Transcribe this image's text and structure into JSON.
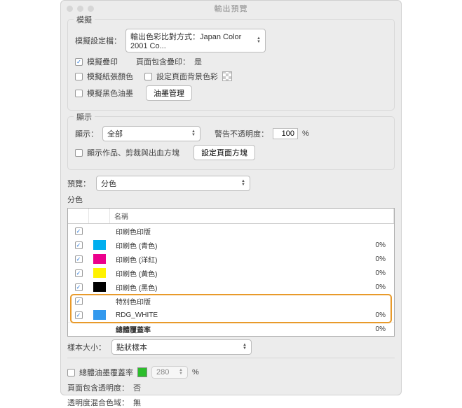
{
  "window": {
    "title": "輸出預覽"
  },
  "simulate": {
    "title": "模擬",
    "profile_label": "模擬設定檔：",
    "profile_value": "輸出色彩比對方式：Japan Color 2001 Co...",
    "overprint_checked": "✓",
    "overprint_label": "模擬疊印",
    "page_contains_overprint_label": "頁面包含疊印：",
    "page_contains_overprint_value": "是",
    "paper_label": "模擬紙張顏色",
    "set_bg_label": "設定頁面背景色彩",
    "black_ink_label": "模擬黑色油墨",
    "ink_mgmt_btn": "油墨管理"
  },
  "display": {
    "title": "顯示",
    "show_label": "顯示：",
    "show_value": "全部",
    "warn_label": "警告不透明度：",
    "warn_value": "100",
    "warn_unit": "%",
    "art_label": "顯示作品、剪裁與出血方塊",
    "set_box_btn": "設定頁面方塊"
  },
  "preview": {
    "label": "預覽：",
    "value": "分色"
  },
  "separations": {
    "title": "分色",
    "col_name": "名稱",
    "rows": [
      {
        "checked": "✓",
        "swatch": "#ffffff",
        "name": "印刷色印版",
        "pct": ""
      },
      {
        "checked": "✓",
        "swatch": "#00aeef",
        "name": "印刷色 (青色)",
        "pct": "0%"
      },
      {
        "checked": "✓",
        "swatch": "#ec008c",
        "name": "印刷色 (洋紅)",
        "pct": "0%"
      },
      {
        "checked": "✓",
        "swatch": "#fff200",
        "name": "印刷色 (黃色)",
        "pct": "0%"
      },
      {
        "checked": "✓",
        "swatch": "#000000",
        "name": "印刷色 (黑色)",
        "pct": "0%"
      },
      {
        "checked": "✓",
        "swatch": "",
        "name": "特別色印版",
        "pct": ""
      },
      {
        "checked": "✓",
        "swatch": "#3399ee",
        "name": "RDG_WHITE",
        "pct": "0%"
      }
    ],
    "total_label": "總體覆蓋率",
    "total_value": "0%"
  },
  "sample": {
    "label": "樣本大小：",
    "value": "點狀樣本"
  },
  "footer": {
    "tac_label": "總體油墨覆蓋率",
    "tac_value": "280",
    "tac_unit": "%",
    "transparency_label": "頁面包含透明度：",
    "transparency_value": "否",
    "blend_label": "透明度混合色域：",
    "blend_value": "無"
  }
}
